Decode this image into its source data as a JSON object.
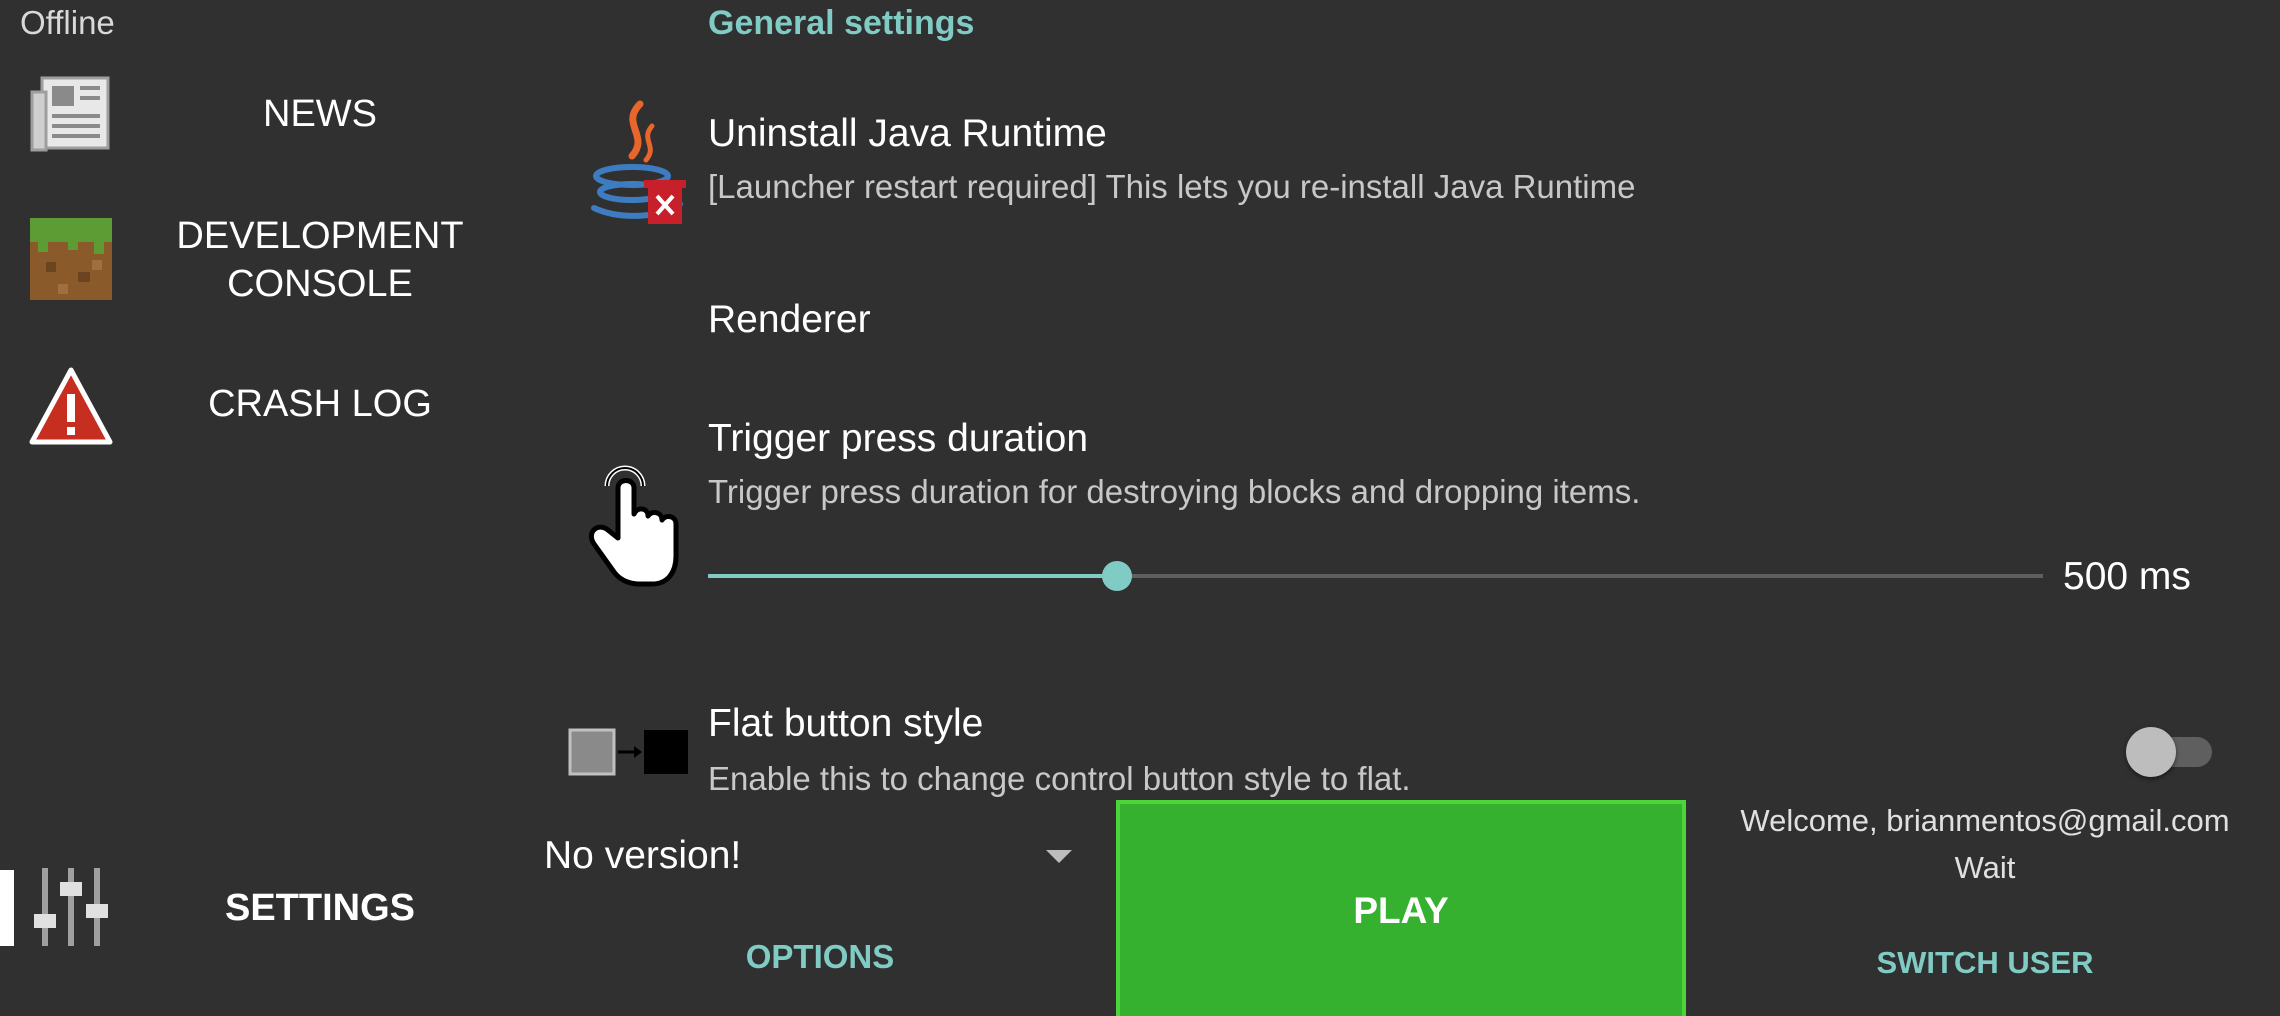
{
  "sidebar": {
    "status": "Offline",
    "items": [
      {
        "label": "NEWS",
        "icon": "newspaper-icon"
      },
      {
        "label": "DEVELOPMENT\nCONSOLE",
        "icon": "grass-block-icon"
      },
      {
        "label": "CRASH LOG",
        "icon": "warning-icon"
      },
      {
        "label": "SETTINGS",
        "icon": "sliders-icon",
        "selected": true
      }
    ]
  },
  "settings": {
    "section_header": "General settings",
    "uninstall_java": {
      "title": "Uninstall Java Runtime",
      "summary": "[Launcher restart required] This lets you re-install Java Runtime",
      "icon": "java-uninstall-icon"
    },
    "renderer": {
      "title": "Renderer"
    },
    "trigger_press": {
      "title": "Trigger press duration",
      "summary": "Trigger press duration for destroying blocks and dropping items.",
      "icon": "hand-pointer-icon",
      "value_label": "500 ms",
      "slider_fraction": 0.306
    },
    "flat_button": {
      "title": "Flat button style",
      "summary": "Enable this to change control button style to flat.",
      "icon": "button-style-icon",
      "enabled": false
    }
  },
  "bottom": {
    "version": "No version!",
    "options_label": "OPTIONS",
    "play_label": "PLAY",
    "welcome": "Welcome, brianmentos@gmail.com",
    "wait": "Wait",
    "switch_user_label": "SWITCH USER"
  },
  "colors": {
    "background": "#303030",
    "accent": "#80cbc4",
    "play": "#36b02f"
  }
}
